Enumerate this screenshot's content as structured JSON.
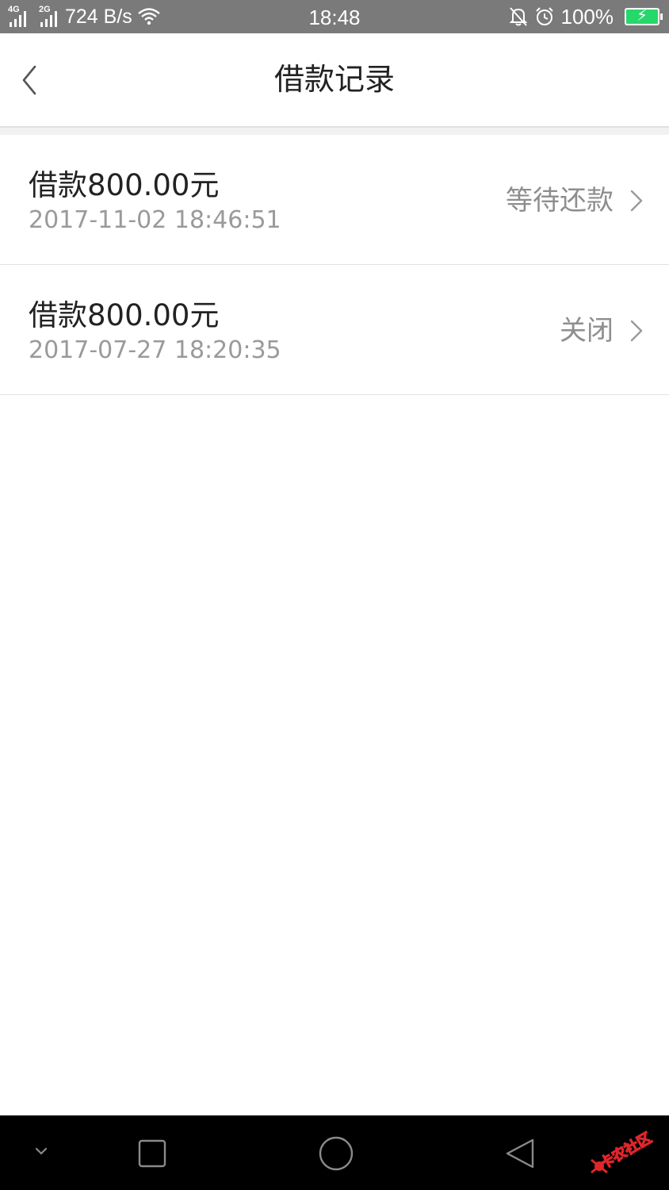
{
  "status_bar": {
    "net1": "4G",
    "net2": "2G",
    "speed": "724 B/s",
    "time": "18:48",
    "battery": "100%",
    "icons": [
      "signal-icon",
      "wifi-icon",
      "bell-off-icon",
      "alarm-icon",
      "battery-icon"
    ]
  },
  "header": {
    "title": "借款记录",
    "back_icon": "chevron-left-icon"
  },
  "loans": [
    {
      "title": "借款800.00元",
      "time": "2017-11-02 18:46:51",
      "status": "等待还款"
    },
    {
      "title": "借款800.00元",
      "time": "2017-07-27 18:20:35",
      "status": "关闭"
    }
  ],
  "nav_bar": {
    "icons": [
      "collapse-icon",
      "recents-icon",
      "home-icon",
      "back-icon"
    ]
  },
  "watermark": {
    "text": "卡农社区"
  },
  "colors": {
    "status_bar_bg": "#7a7a7a",
    "battery_fill": "#26d86a",
    "title_text": "#222222",
    "secondary_text": "#9a9a9a",
    "nav_bar_bg": "#000000",
    "watermark": "#e0262b"
  }
}
